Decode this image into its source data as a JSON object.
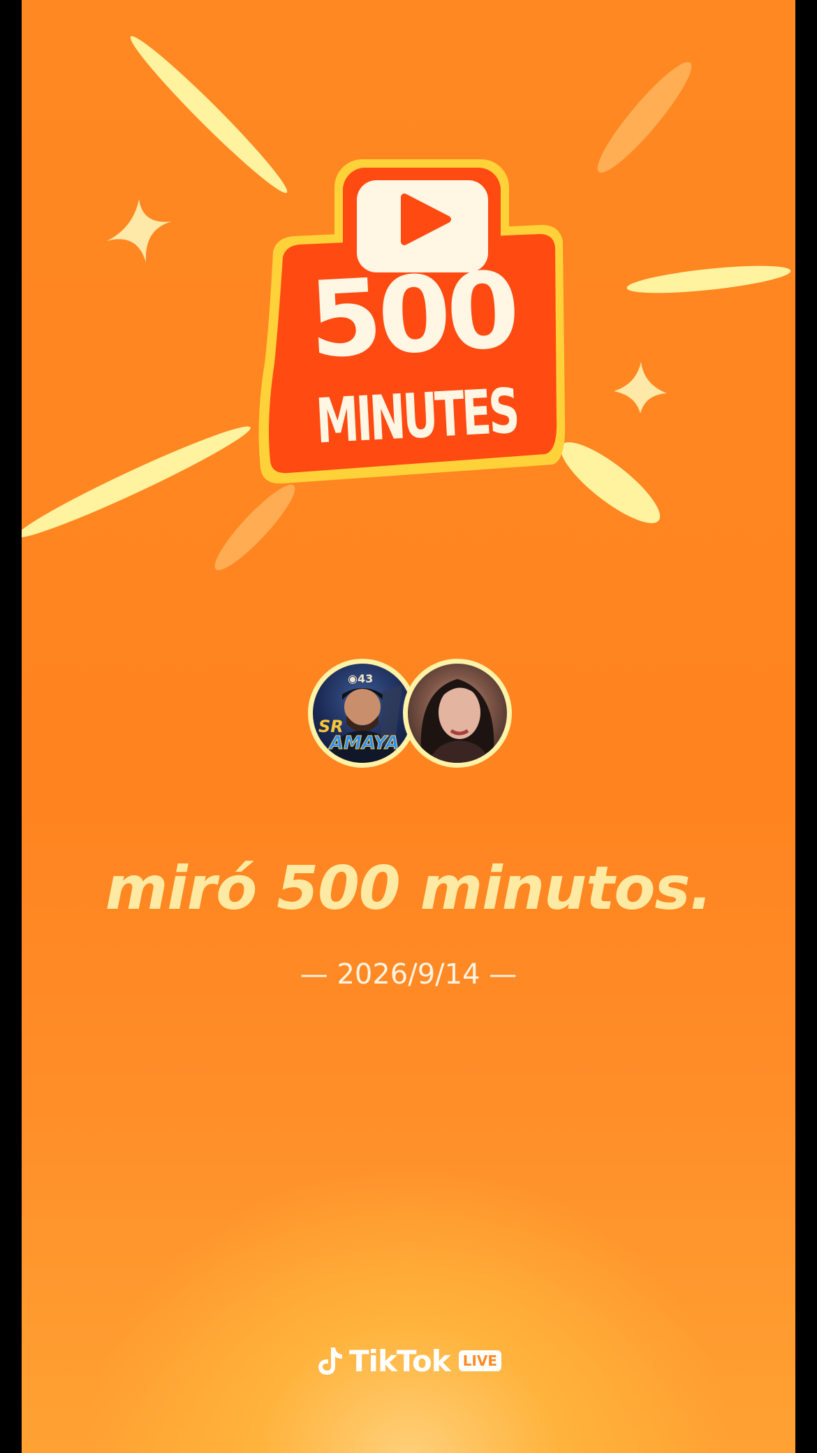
{
  "badge": {
    "number": "500",
    "word": "MINUTES",
    "icon": "play-icon"
  },
  "avatars": {
    "first": {
      "level": "43",
      "alt_text": "SR AMAYA"
    },
    "second": {}
  },
  "headline": "miró 500 minutos.",
  "date": "— 2026/9/14 —",
  "brand": {
    "name": "TikTok",
    "tag": "LIVE",
    "icon": "tiktok-note-icon"
  },
  "colors": {
    "background": "#ff8420",
    "badge_red": "#ff4a12",
    "badge_yellow": "#ffd23a",
    "cream": "#fff6e4",
    "headline": "#ffeaa3"
  }
}
